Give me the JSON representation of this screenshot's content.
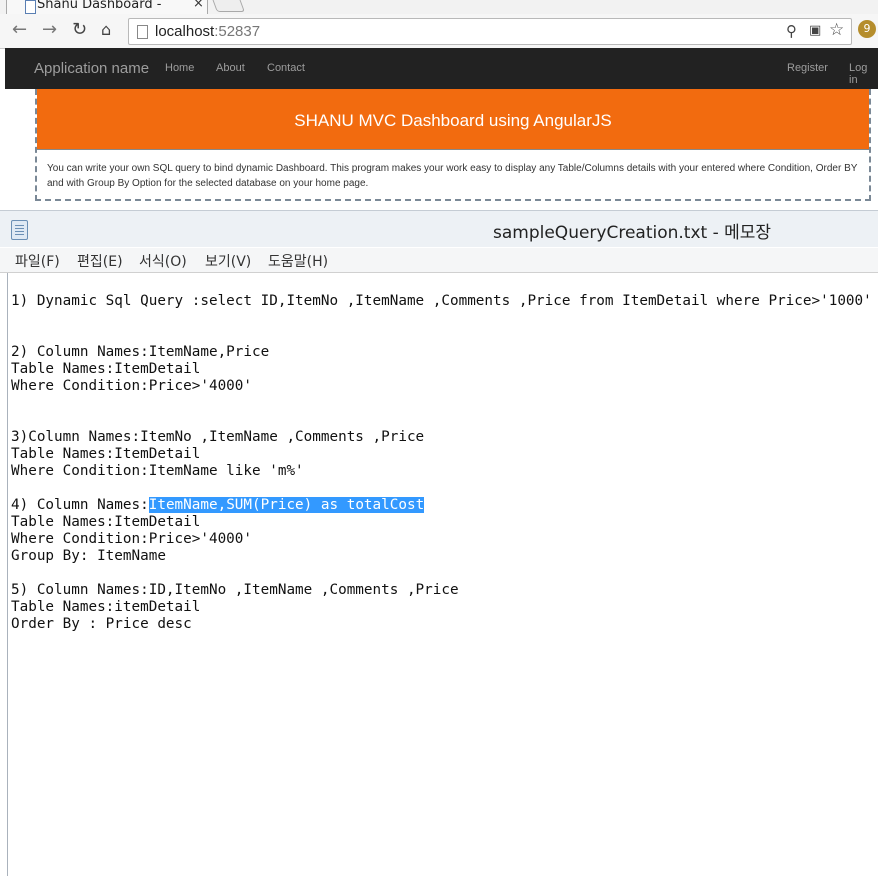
{
  "browser": {
    "tab_title": "Shanu Dashboard -",
    "tab_close": "×",
    "url_host": "localhost",
    "url_port": ":52837"
  },
  "website": {
    "brand": "Application name",
    "nav_links": [
      "Home",
      "About",
      "Contact"
    ],
    "right_links": [
      "Register",
      "Log in"
    ],
    "banner_title": "SHANU MVC Dashboard using AngularJS",
    "banner_description": "You can write your own SQL query to bind dynamic Dashboard. This program makes your work easy to display any Table/Columns details with your entered where Condition, Order BY and with Group By Option for the selected database on your home page."
  },
  "notepad": {
    "title": "sampleQueryCreation.txt - 메모장",
    "menu": [
      "파일(F)",
      "편집(E)",
      "서식(O)",
      "보기(V)",
      "도움말(H)"
    ],
    "lines": {
      "q1": "1) Dynamic Sql Query :select ID,ItemNo ,ItemName ,Comments ,Price from ItemDetail where Price>'1000'",
      "q2_columns": "2) Column Names:ItemName,Price",
      "q2_table": "Table Names:ItemDetail",
      "q2_where": "Where Condition:Price>'4000'",
      "q3_columns": "3)Column Names:ItemNo ,ItemName ,Comments ,Price",
      "q3_table": "Table Names:ItemDetail",
      "q3_where": "Where Condition:ItemName like 'm%'",
      "q4_columns_prefix": "4) Column Names:",
      "q4_columns_selected": "ItemName,SUM(Price) as totalCost",
      "q4_table": "Table Names:ItemDetail",
      "q4_where": "Where Condition:Price>'4000'",
      "q4_group": "Group By: ItemName",
      "q5_columns": "5) Column Names:ID,ItemNo ,ItemName ,Comments ,Price",
      "q5_table": "Table Names:itemDetail",
      "q5_order": "Order By : Price desc"
    }
  },
  "colors": {
    "banner": "#f26b0f",
    "navbar": "#222222",
    "selection": "#3399ff"
  }
}
